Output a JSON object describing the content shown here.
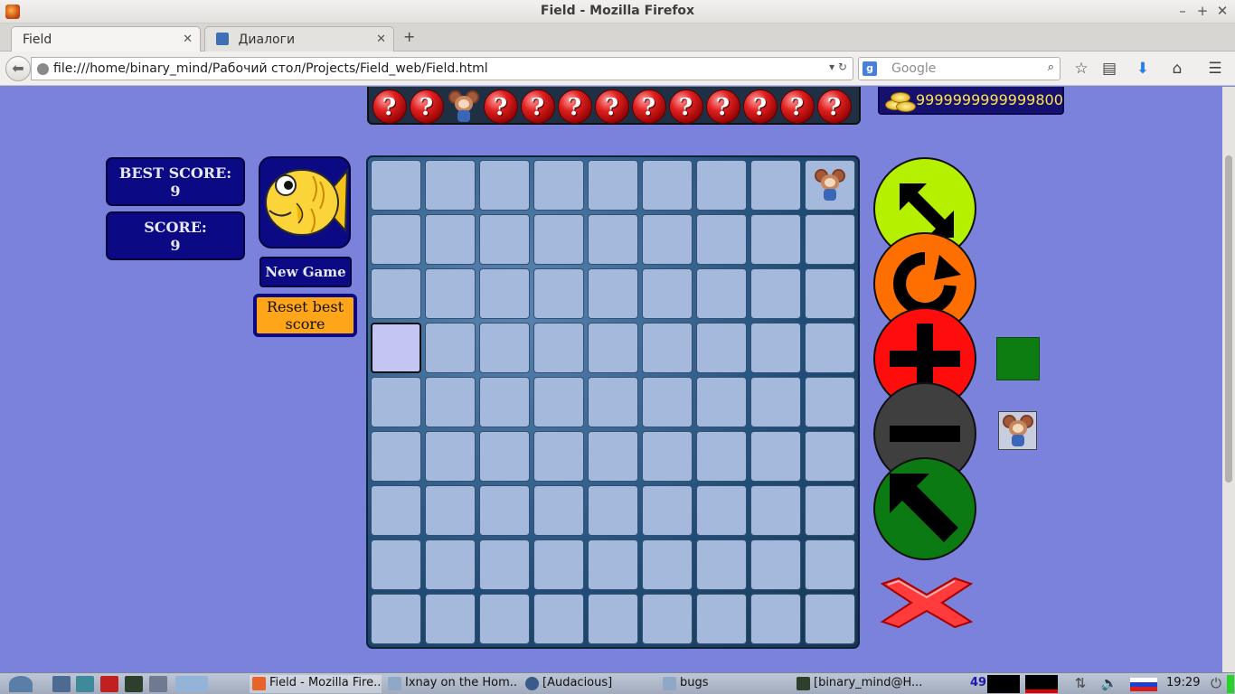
{
  "window": {
    "title": "Field - Mozilla Firefox"
  },
  "tabs": [
    {
      "label": "Field",
      "active": true
    },
    {
      "label": "Диалоги",
      "active": false
    }
  ],
  "url": "file:///home/binary_mind/Рабочий стол/Projects/Field_web/Field.html",
  "search": {
    "engine": "Google",
    "placeholder": "Google"
  },
  "game": {
    "coins": "9999999999999800",
    "best_score_label": "BEST SCORE:",
    "best_score": "9",
    "score_label": "SCORE:",
    "score": "9",
    "new_game_label": "New Game",
    "reset_label": "Reset best score",
    "top_strip": [
      "?",
      "?",
      "mouse",
      "?",
      "?",
      "?",
      "?",
      "?",
      "?",
      "?",
      "?",
      "?",
      "?"
    ],
    "board": {
      "rows": 9,
      "cols": 9,
      "mouse_cell": [
        0,
        8
      ],
      "selected_cell": [
        3,
        0
      ]
    },
    "controls": [
      {
        "name": "resize-button",
        "color": "#b4f000",
        "icon": "diagonal-resize-arrow-icon"
      },
      {
        "name": "rotate-button",
        "color": "#ff6f00",
        "icon": "rotate-arrow-icon"
      },
      {
        "name": "plus-button",
        "color": "#ff0d0d",
        "icon": "plus-icon"
      },
      {
        "name": "minus-button",
        "color": "#3f3f3f",
        "icon": "minus-icon"
      },
      {
        "name": "move-button",
        "color": "#0b7a12",
        "icon": "up-left-arrow-icon"
      }
    ],
    "side_square_color": "#0d7d12"
  },
  "taskbar": {
    "items": [
      {
        "label": "Field - Mozilla Fire...",
        "icon": "firefox-icon"
      },
      {
        "label": "Ixnay on the Hom...",
        "icon": "folder-icon"
      },
      {
        "label": "[Audacious]",
        "icon": "audacious-icon"
      },
      {
        "label": "bugs",
        "icon": "folder-icon"
      },
      {
        "label": "[binary_mind@H...",
        "icon": "terminal-icon"
      }
    ],
    "counter": "49",
    "clock": "19:29"
  }
}
